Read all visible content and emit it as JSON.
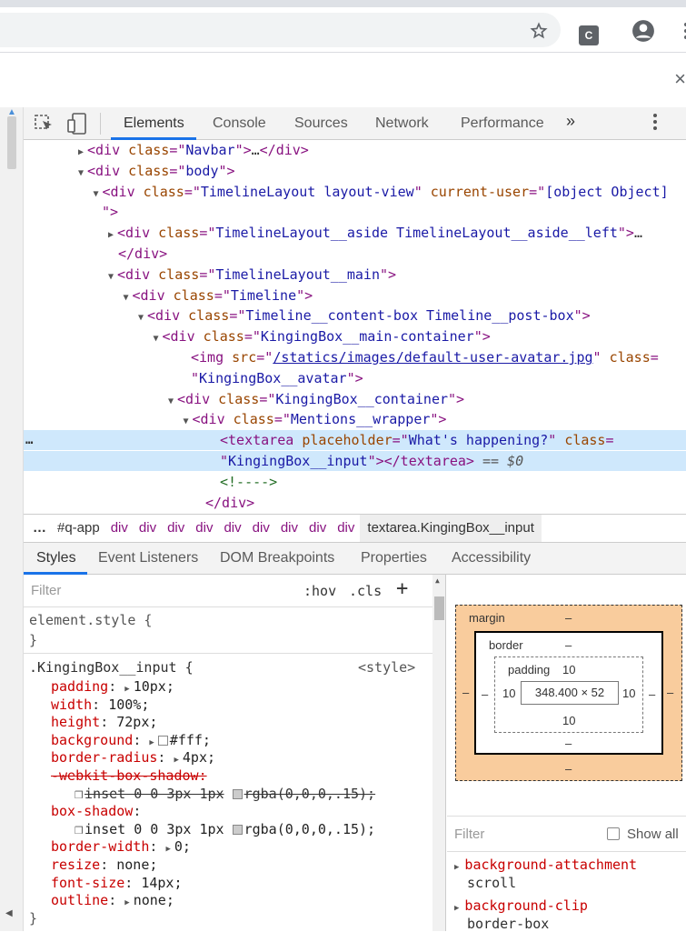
{
  "browser": {
    "star_icon": "star-icon",
    "extension_label": "C",
    "profile_icon": "account-circle-icon",
    "menu_icon": "kebab-icon",
    "close_glyph": "×"
  },
  "devtools": {
    "tabs": [
      "Elements",
      "Console",
      "Sources",
      "Network",
      "Performance"
    ],
    "more_tabs": "»",
    "tree": [
      {
        "indent": 0,
        "tri": "▶",
        "parts": [
          [
            "tag",
            "<div "
          ],
          [
            "an",
            "class"
          ],
          [
            "tag",
            "=\""
          ],
          [
            "av",
            "Navbar"
          ],
          [
            "tag",
            "\">"
          ],
          [
            "plain",
            "…"
          ],
          [
            "tag",
            "</div>"
          ]
        ]
      },
      {
        "indent": 0,
        "tri": "▼",
        "parts": [
          [
            "tag",
            "<div "
          ],
          [
            "an",
            "class"
          ],
          [
            "tag",
            "=\""
          ],
          [
            "av",
            "body"
          ],
          [
            "tag",
            "\">"
          ]
        ]
      },
      {
        "indent": 1,
        "tri": "▼",
        "parts": [
          [
            "tag",
            "<div "
          ],
          [
            "an",
            "class"
          ],
          [
            "tag",
            "=\""
          ],
          [
            "av",
            "TimelineLayout layout-view"
          ],
          [
            "tag",
            "\" "
          ],
          [
            "an",
            "current-user"
          ],
          [
            "tag",
            "=\""
          ],
          [
            "av",
            "[object Object]"
          ]
        ]
      },
      {
        "indent": 0,
        "tri": "",
        "parts": [
          [
            "tag",
            "\">"
          ]
        ]
      },
      {
        "indent": 2,
        "tri": "▶",
        "parts": [
          [
            "tag",
            "<div "
          ],
          [
            "an",
            "class"
          ],
          [
            "tag",
            "=\""
          ],
          [
            "av",
            "TimelineLayout__aside TimelineLayout__aside__left"
          ],
          [
            "tag",
            "\">"
          ],
          [
            "plain",
            "…"
          ]
        ]
      },
      {
        "indent": 2,
        "tri": "",
        "parts": [
          [
            "tag",
            "</div>"
          ]
        ]
      },
      {
        "indent": 2,
        "tri": "▼",
        "parts": [
          [
            "tag",
            "<div "
          ],
          [
            "an",
            "class"
          ],
          [
            "tag",
            "=\""
          ],
          [
            "av",
            "TimelineLayout__main"
          ],
          [
            "tag",
            "\">"
          ]
        ]
      },
      {
        "indent": 3,
        "tri": "▼",
        "parts": [
          [
            "tag",
            "<div "
          ],
          [
            "an",
            "class"
          ],
          [
            "tag",
            "=\""
          ],
          [
            "av",
            "Timeline"
          ],
          [
            "tag",
            "\">"
          ]
        ]
      },
      {
        "indent": 4,
        "tri": "▼",
        "parts": [
          [
            "tag",
            "<div "
          ],
          [
            "an",
            "class"
          ],
          [
            "tag",
            "=\""
          ],
          [
            "av",
            "Timeline__content-box Timeline__post-box"
          ],
          [
            "tag",
            "\">"
          ]
        ]
      },
      {
        "indent": 5,
        "tri": "▼",
        "parts": [
          [
            "tag",
            "<div "
          ],
          [
            "an",
            "class"
          ],
          [
            "tag",
            "=\""
          ],
          [
            "av",
            "KingingBox__main-container"
          ],
          [
            "tag",
            "\">"
          ]
        ]
      },
      {
        "indent": 6,
        "tri": "",
        "parts": [
          [
            "tag",
            "<img "
          ],
          [
            "an",
            "src"
          ],
          [
            "tag",
            "=\""
          ],
          [
            "link",
            "/statics/images/default-user-avatar.jpg"
          ],
          [
            "tag",
            "\" "
          ],
          [
            "an",
            "class"
          ],
          [
            "tag",
            "="
          ]
        ]
      },
      {
        "indent": 6,
        "tri": "",
        "parts": [
          [
            "tag",
            "\""
          ],
          [
            "av",
            "KingingBox__avatar"
          ],
          [
            "tag",
            "\">"
          ]
        ]
      },
      {
        "indent": 6,
        "tri": "▼",
        "parts": [
          [
            "tag",
            "<div "
          ],
          [
            "an",
            "class"
          ],
          [
            "tag",
            "=\""
          ],
          [
            "av",
            "KingingBox__container"
          ],
          [
            "tag",
            "\">"
          ]
        ]
      },
      {
        "indent": 7,
        "tri": "▼",
        "parts": [
          [
            "tag",
            "<div "
          ],
          [
            "an",
            "class"
          ],
          [
            "tag",
            "=\""
          ],
          [
            "av",
            "Mentions__wrapper"
          ],
          [
            "tag",
            "\">"
          ]
        ]
      },
      {
        "indent": 8,
        "tri": "",
        "sel": true,
        "parts": [
          [
            "tag",
            "<textarea "
          ],
          [
            "an",
            "placeholder"
          ],
          [
            "tag",
            "=\""
          ],
          [
            "av",
            "What's happening?"
          ],
          [
            "tag",
            "\" "
          ],
          [
            "an",
            "class"
          ],
          [
            "tag",
            "="
          ]
        ]
      },
      {
        "indent": 8,
        "tri": "",
        "sel": true,
        "parts": [
          [
            "tag",
            "\""
          ],
          [
            "av",
            "KingingBox__input"
          ],
          [
            "tag",
            "\"></textarea>"
          ],
          [
            "eq",
            " == $0"
          ]
        ]
      },
      {
        "indent": 8,
        "tri": "",
        "parts": [
          [
            "cm",
            "<!---->"
          ]
        ]
      },
      {
        "indent": 7,
        "tri": "",
        "parts": [
          [
            "tag",
            "</div>"
          ]
        ]
      }
    ],
    "selected_marker": "…",
    "breadcrumbs": [
      "…",
      "#q-app",
      "div",
      "div",
      "div",
      "div",
      "div",
      "div",
      "div",
      "div",
      "div",
      "textarea.KingingBox__input"
    ],
    "sub_tabs": [
      "Styles",
      "Event Listeners",
      "DOM Breakpoints",
      "Properties",
      "Accessibility"
    ],
    "styles": {
      "filter_placeholder": "Filter",
      "hov": ":hov",
      "cls": ".cls",
      "plus": "+",
      "element_style": "element.style {",
      "element_close": "}",
      "rule_selector": ".KingingBox__input {",
      "rule_source": "<style>",
      "props": [
        {
          "name": "padding",
          "tri": true,
          "value": "10px;"
        },
        {
          "name": "width",
          "value": "100%;"
        },
        {
          "name": "height",
          "value": "72px;"
        },
        {
          "name": "background",
          "tri": true,
          "swatch": "#ffffff",
          "value": "#fff;"
        },
        {
          "name": "border-radius",
          "tri": true,
          "value": "4px;"
        },
        {
          "name": "-webkit-box-shadow",
          "struck": true,
          "value": ""
        },
        {
          "sub": true,
          "struck": true,
          "swatch": "#cccccc",
          "value": "inset 0 0 3px 1px",
          "value2": "rgba(0,0,0,.15);"
        },
        {
          "name": "box-shadow",
          "value": ""
        },
        {
          "sub": true,
          "swatch": "#cccccc",
          "value": "inset 0 0 3px 1px",
          "value2": "rgba(0,0,0,.15);"
        },
        {
          "name": "border-width",
          "tri": true,
          "value": "0;"
        },
        {
          "name": "resize",
          "value": "none;"
        },
        {
          "name": "font-size",
          "value": "14px;"
        },
        {
          "name": "outline",
          "tri": true,
          "value": "none;"
        }
      ],
      "rule_close": "}"
    },
    "box_model": {
      "margin_label": "margin",
      "margin_top": "–",
      "margin_bottom": "–",
      "margin_left": "–",
      "margin_right": "–",
      "border_label": "border",
      "border_top": "–",
      "border_bottom": "–",
      "border_left": "–",
      "border_right": "–",
      "padding_label": "padding",
      "padding_top": "10",
      "padding_bottom": "10",
      "padding_left": "10",
      "padding_right": "10",
      "content": "348.400 × 52"
    },
    "computed": {
      "filter_placeholder": "Filter",
      "show_all": "Show all",
      "props": [
        {
          "name": "background-attachment",
          "value": "scroll"
        },
        {
          "name": "background-clip",
          "value": "border-box"
        }
      ]
    }
  }
}
